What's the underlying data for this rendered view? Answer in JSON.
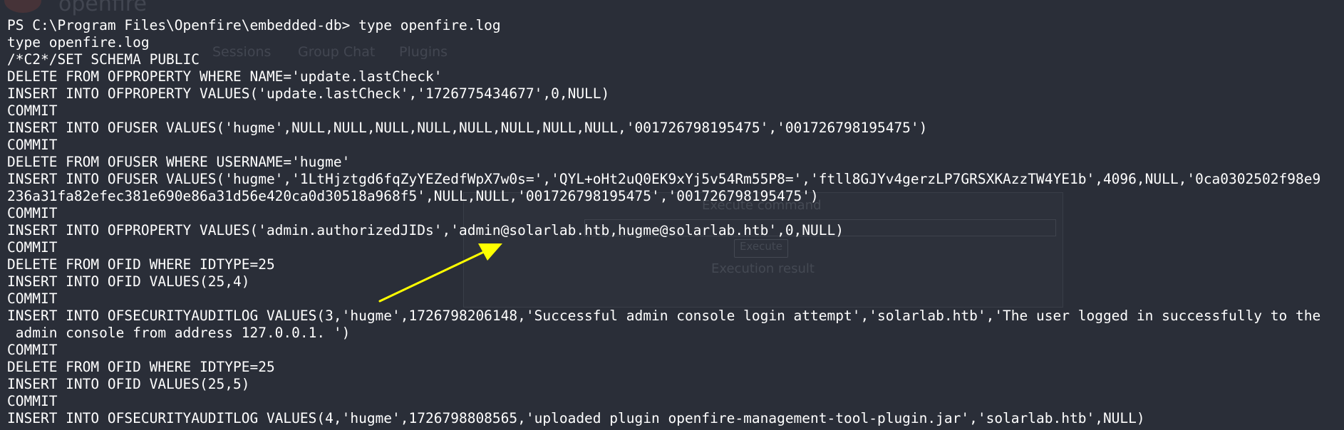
{
  "background_ui": {
    "logo_text": "openfire",
    "tabs": [
      "Sessions",
      "Group Chat",
      "Plugins"
    ],
    "panel_title": "Execute command",
    "execute_button": "Execute",
    "result_label": "Execution result"
  },
  "terminal": {
    "lines": [
      "PS C:\\Program Files\\Openfire\\embedded-db> type openfire.log",
      "type openfire.log",
      "/*C2*/SET SCHEMA PUBLIC",
      "DELETE FROM OFPROPERTY WHERE NAME='update.lastCheck'",
      "INSERT INTO OFPROPERTY VALUES('update.lastCheck','1726775434677',0,NULL)",
      "COMMIT",
      "INSERT INTO OFUSER VALUES('hugme',NULL,NULL,NULL,NULL,NULL,NULL,NULL,NULL,'001726798195475','001726798195475')",
      "COMMIT",
      "DELETE FROM OFUSER WHERE USERNAME='hugme'",
      "INSERT INTO OFUSER VALUES('hugme','1LtHjztgd6fqZyYEZedfWpX7w0s=','QYL+oHt2uQ0EK9xYj5v54Rm55P8=','ftll8GJYv4gerzLP7GRSXKAzzTW4YE1b',4096,NULL,'0ca0302502f98e9",
      "236a31fa82efec381e690e86a31d56e420ca0d30518a968f5',NULL,NULL,'001726798195475','001726798195475')",
      "COMMIT",
      "INSERT INTO OFPROPERTY VALUES('admin.authorizedJIDs','admin@solarlab.htb,hugme@solarlab.htb',0,NULL)",
      "COMMIT",
      "DELETE FROM OFID WHERE IDTYPE=25",
      "INSERT INTO OFID VALUES(25,4)",
      "COMMIT",
      "INSERT INTO OFSECURITYAUDITLOG VALUES(3,'hugme',1726798206148,'Successful admin console login attempt','solarlab.htb','The user logged in successfully to the",
      " admin console from address 127.0.0.1. ')",
      "COMMIT",
      "DELETE FROM OFID WHERE IDTYPE=25",
      "INSERT INTO OFID VALUES(25,5)",
      "COMMIT",
      "INSERT INTO OFSECURITYAUDITLOG VALUES(4,'hugme',1726798808565,'uploaded plugin openfire-management-tool-plugin.jar','solarlab.htb',NULL)"
    ]
  },
  "colors": {
    "background": "#2a2e38",
    "text": "#ffffff",
    "arrow": "#ffff00"
  },
  "annotation": {
    "icon": "yellow-arrow-icon"
  }
}
